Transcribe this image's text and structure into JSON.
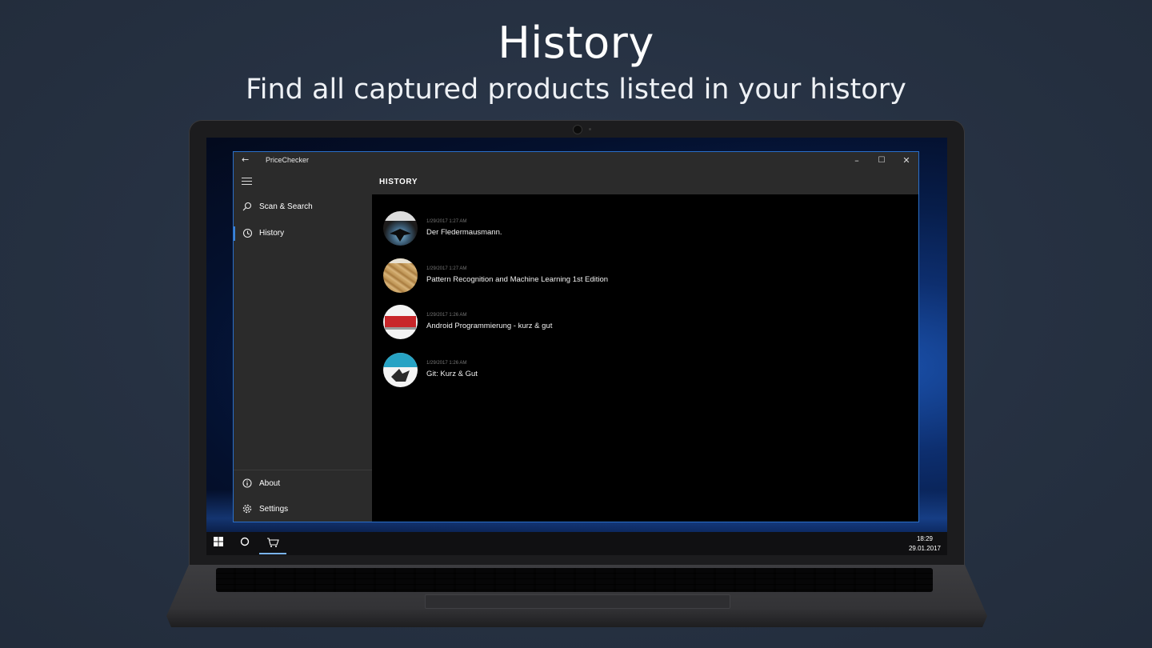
{
  "hero": {
    "title": "History",
    "subtitle": "Find all captured products listed in your history"
  },
  "window": {
    "app_title": "PriceChecker",
    "back_icon": "arrow-left-icon",
    "minimize_label": "–",
    "maximize_label": "☐",
    "close_label": "✕"
  },
  "header": {
    "page_title": "HISTORY"
  },
  "sidebar": {
    "items": [
      {
        "label": "Scan & Search",
        "icon": "search-icon"
      },
      {
        "label": "History",
        "icon": "history-icon",
        "active": true
      }
    ],
    "footer_items": [
      {
        "label": "About",
        "icon": "info-icon"
      },
      {
        "label": "Settings",
        "icon": "gear-icon"
      }
    ]
  },
  "history": [
    {
      "date": "1/29/2017 1:27 AM",
      "name": "Der Fledermausmann."
    },
    {
      "date": "1/29/2017 1:27 AM",
      "name": "Pattern Recognition and Machine  Learning 1st Edition"
    },
    {
      "date": "1/29/2017 1:26 AM",
      "name": "Android Programmierung - kurz & gut"
    },
    {
      "date": "1/29/2017 1:26 AM",
      "name": "Git: Kurz & Gut"
    }
  ],
  "taskbar": {
    "time": "18:29",
    "date": "29.01.2017"
  },
  "colors": {
    "accent": "#3b84d8",
    "window_border": "#2a6fc9",
    "chrome": "#2b2b2b",
    "background": "#263142"
  }
}
